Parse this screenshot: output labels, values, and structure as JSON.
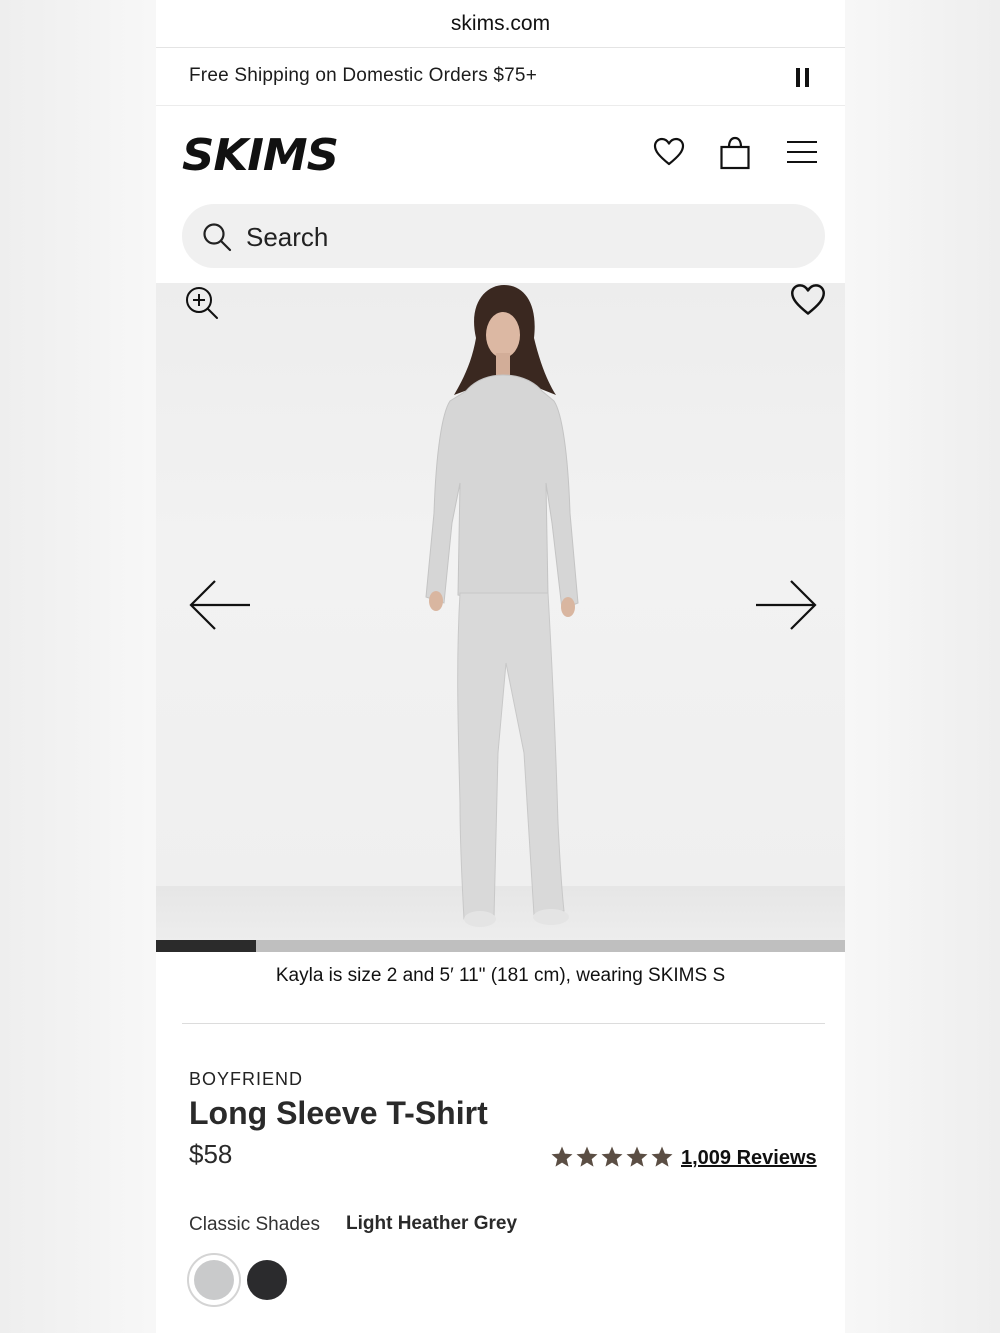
{
  "browser": {
    "url": "skims.com"
  },
  "promo": {
    "text": "Free Shipping on Domestic Orders $75+",
    "control_icon": "pause-icon"
  },
  "header": {
    "logo_text": "SKIMS",
    "icons": [
      "heart-icon",
      "shopping-bag-icon",
      "hamburger-menu-icon"
    ]
  },
  "search": {
    "placeholder": "Search",
    "icon": "search-icon"
  },
  "gallery": {
    "icons": [
      "zoom-in-icon",
      "heart-icon",
      "arrow-left-icon",
      "arrow-right-icon"
    ],
    "progress_fraction": 0.145,
    "caption": "Kayla is size 2 and 5′ 11\" (181 cm), wearing SKIMS S"
  },
  "product": {
    "collection": "BOYFRIEND",
    "title": "Long Sleeve T-Shirt",
    "price": "$58",
    "rating_stars": 5,
    "reviews": "1,009 Reviews",
    "shade_group": "Classic Shades",
    "shade_selected": "Light Heather Grey",
    "swatches": [
      {
        "color": "#c9cacb",
        "selected": true
      },
      {
        "color": "#2b2b2d",
        "selected": false
      }
    ]
  },
  "colors": {
    "star": "#5b4e44",
    "progress_fill": "#2b2b2b",
    "progress_track": "#bfbfbf",
    "search_bg": "#f0f0f0"
  }
}
